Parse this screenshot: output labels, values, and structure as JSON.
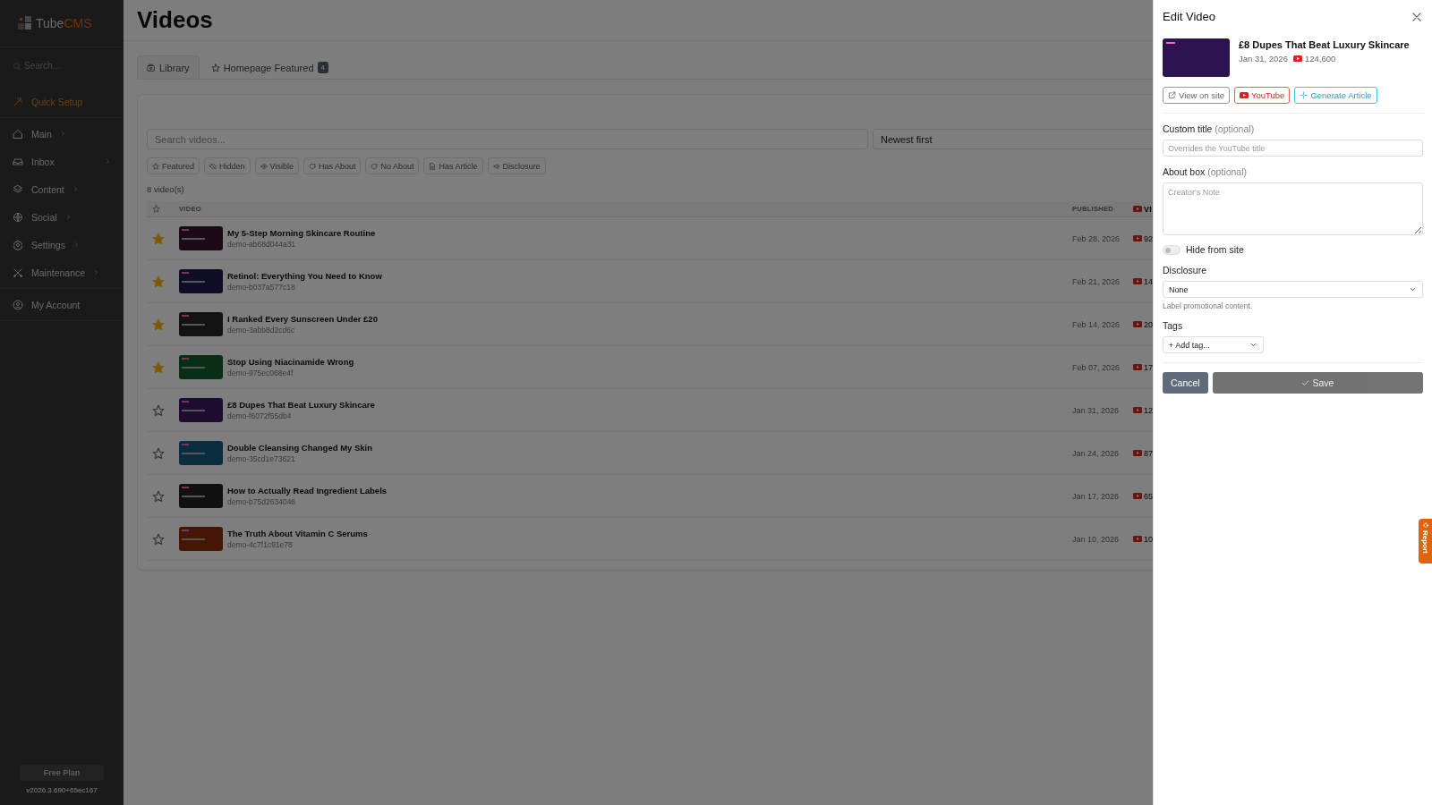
{
  "sidebar": {
    "brand": {
      "main": "Tube",
      "accent": "CMS"
    },
    "search": {
      "placeholder": "Search..."
    },
    "sections": [
      {
        "items": [
          {
            "label": "Quick Setup",
            "selected": true,
            "has_submenu": false
          }
        ]
      },
      {
        "items": [
          {
            "label": "Main",
            "selected": false,
            "has_submenu": true
          },
          {
            "label": "Inbox",
            "selected": false,
            "has_submenu": true
          },
          {
            "label": "Content",
            "selected": false,
            "has_submenu": true
          },
          {
            "label": "Social",
            "selected": false,
            "has_submenu": true
          },
          {
            "label": "Settings",
            "selected": false,
            "has_submenu": true
          },
          {
            "label": "Maintenance",
            "selected": false,
            "has_submenu": true
          }
        ]
      },
      {
        "items": [
          {
            "label": "My Account",
            "selected": false,
            "has_submenu": false
          }
        ]
      }
    ],
    "plan_button": "Free Plan",
    "version": "v2026.3.690+65ec167"
  },
  "page": {
    "title": "Videos",
    "tabs": [
      {
        "label": "Library",
        "selected": true
      },
      {
        "label": "Homepage Featured",
        "selected": false,
        "badge": "4"
      }
    ],
    "search": {
      "placeholder": "Search videos..."
    },
    "sort": {
      "value": "Newest first"
    },
    "filters": [
      "Featured",
      "Hidden",
      "Visible",
      "Has About",
      "No About",
      "Has Article",
      "Disclosure"
    ],
    "count": "8 video(s)",
    "table": {
      "columns": [
        "VIDEO",
        "PUBLISHED",
        "VI"
      ],
      "rows": [
        {
          "featured": true,
          "title": "My 5-Step Morning Skincare Routine",
          "id": "demo-ab68d044a31",
          "published": "Feb 28, 2026",
          "views": "92"
        },
        {
          "featured": true,
          "title": "Retinol: Everything You Need to Know",
          "id": "demo-b037a577c18",
          "published": "Feb 21, 2026",
          "views": "14"
        },
        {
          "featured": true,
          "title": "I Ranked Every Sunscreen Under £20",
          "id": "demo-3abb8d2cd6c",
          "published": "Feb 14, 2026",
          "views": "20"
        },
        {
          "featured": true,
          "title": "Stop Using Niacinamide Wrong",
          "id": "demo-975ec068e4f",
          "published": "Feb 07, 2026",
          "views": "17"
        },
        {
          "featured": false,
          "title": "£8 Dupes That Beat Luxury Skincare",
          "id": "demo-f6072f55db4",
          "published": "Jan 31, 2026",
          "views": "12"
        },
        {
          "featured": false,
          "title": "Double Cleansing Changed My Skin",
          "id": "demo-35cd1e73621",
          "published": "Jan 24, 2026",
          "views": "87"
        },
        {
          "featured": false,
          "title": "How to Actually Read Ingredient Labels",
          "id": "demo-b75d2634046",
          "published": "Jan 17, 2026",
          "views": "65"
        },
        {
          "featured": false,
          "title": "The Truth About Vitamin C Serums",
          "id": "demo-4c7f1c91e78",
          "published": "Jan 10, 2026",
          "views": "10"
        }
      ]
    }
  },
  "drawer": {
    "title": "Edit Video",
    "video": {
      "color": "#2d1450",
      "title": "£8 Dupes That Beat Luxury Skincare",
      "date": "Jan 31, 2026",
      "views": "124,600"
    },
    "actions": [
      {
        "kind": "site",
        "label": "View on site"
      },
      {
        "kind": "youtube",
        "label": "YouTube"
      },
      {
        "kind": "generate",
        "label": "Generate Article"
      }
    ],
    "custom_title": {
      "label": "Custom title",
      "hint": "(optional)",
      "placeholder": "Overrides the YouTube title"
    },
    "about": {
      "label": "About box",
      "hint": "(optional)",
      "placeholder": "Creator's Note"
    },
    "hide_from_site": {
      "label": "Hide from site",
      "on": false
    },
    "disclosure": {
      "label": "Disclosure",
      "value": "None",
      "help": "Label promotional content."
    },
    "tags": {
      "label": "Tags",
      "value": "+ Add tag..."
    },
    "buttons": [
      {
        "kind": "cancel",
        "label": "Cancel",
        "disabled": false
      },
      {
        "kind": "save",
        "label": "Save",
        "disabled": true
      }
    ]
  },
  "report_tab": {
    "label": "Report"
  }
}
